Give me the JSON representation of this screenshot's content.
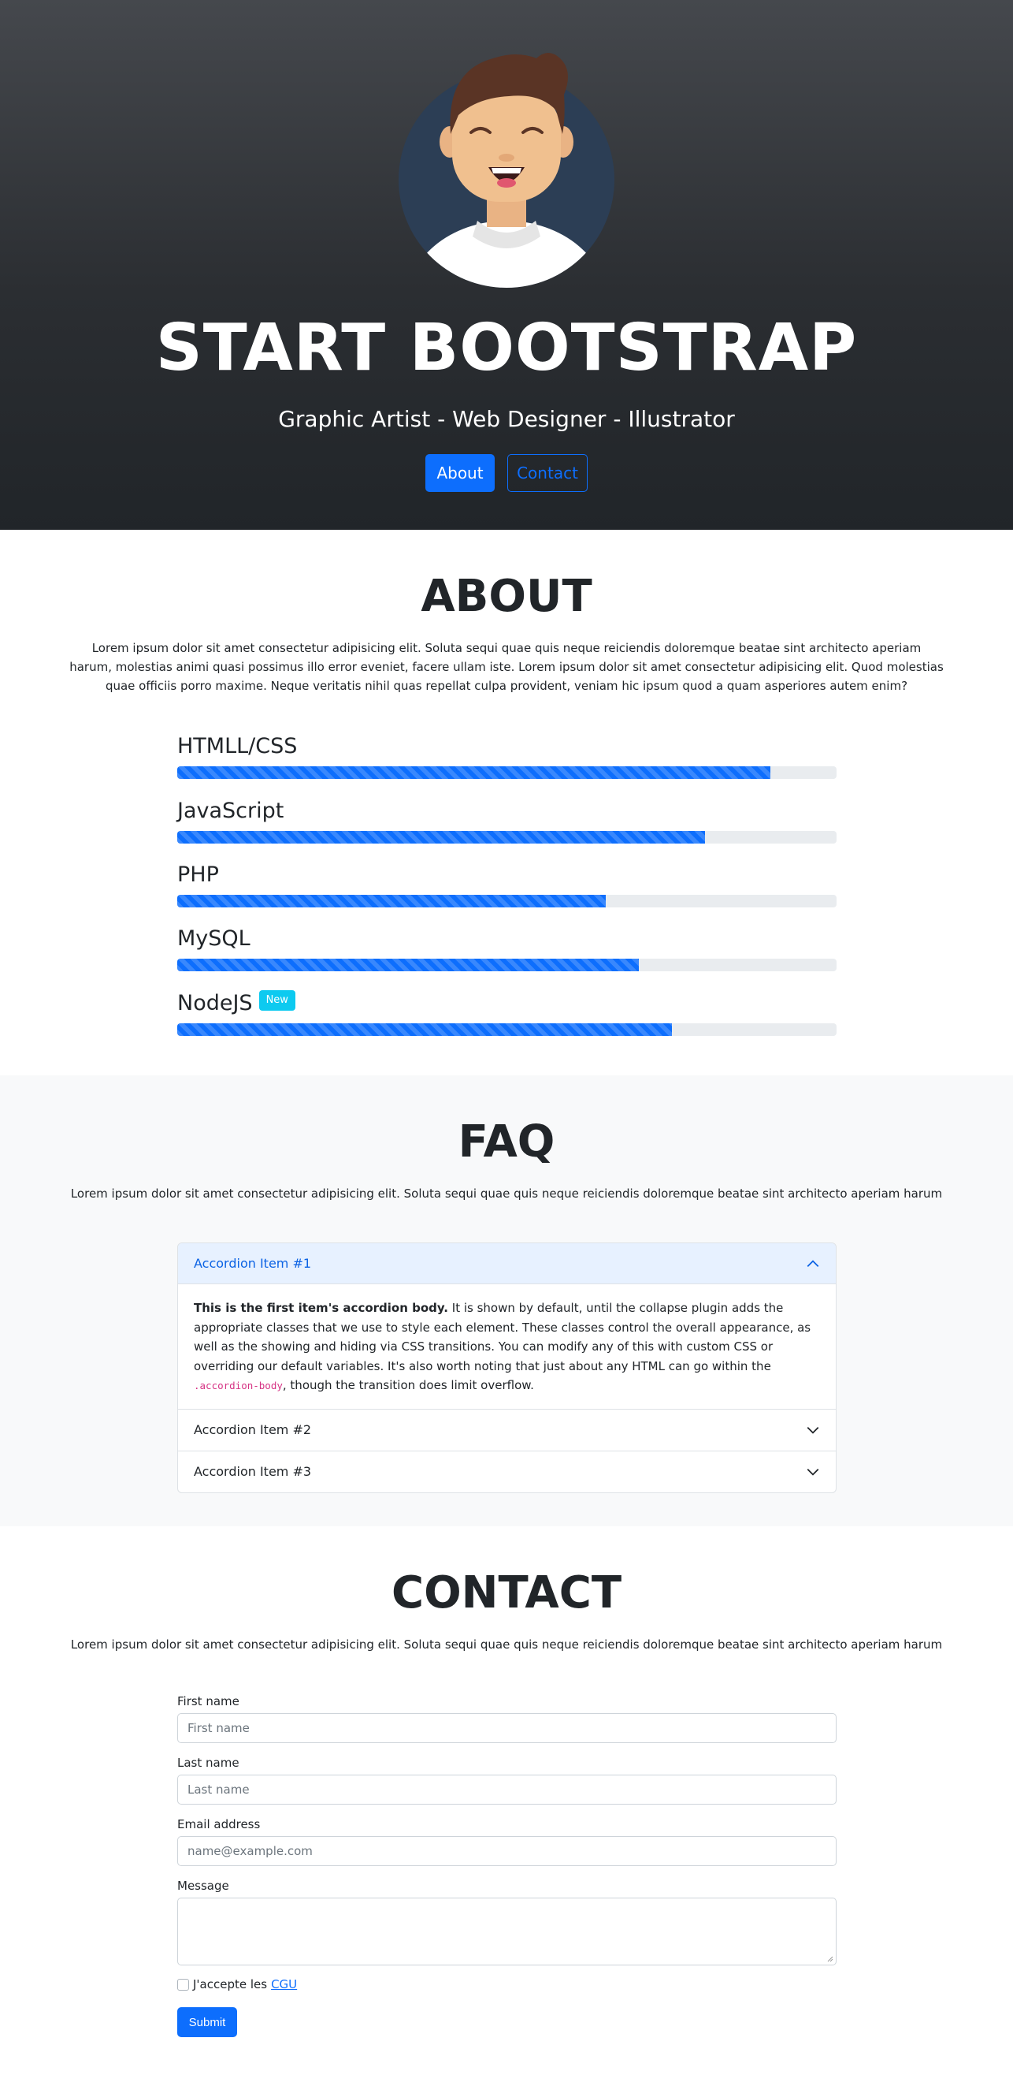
{
  "hero": {
    "title": "START BOOTSTRAP",
    "subtitle": "Graphic Artist - Web Designer - Illustrator",
    "about_btn": "About",
    "contact_btn": "Contact"
  },
  "about": {
    "title": "ABOUT",
    "text": "Lorem ipsum dolor sit amet consectetur adipisicing elit. Soluta sequi quae quis neque reiciendis doloremque beatae sint architecto aperiam harum, molestias animi quasi possimus illo error eveniet, facere ullam iste. Lorem ipsum dolor sit amet consectetur adipisicing elit. Quod molestias quae officiis porro maxime. Neque veritatis nihil quas repellat culpa provident, veniam hic ipsum quod a quam asperiores autem enim?",
    "skills": [
      {
        "label": "HTMLL/CSS",
        "value": 90
      },
      {
        "label": "JavaScript",
        "value": 80
      },
      {
        "label": "PHP",
        "value": 65
      },
      {
        "label": "MySQL",
        "value": 70
      },
      {
        "label": "NodeJS",
        "value": 75,
        "badge": "New"
      }
    ]
  },
  "faq": {
    "title": "FAQ",
    "lead": "Lorem ipsum dolor sit amet consectetur adipisicing elit. Soluta sequi quae quis neque reiciendis doloremque beatae sint architecto aperiam harum",
    "items": [
      {
        "title": "Accordion Item #1",
        "body_strong": "This is the first item's accordion body.",
        "body_text": " It is shown by default, until the collapse plugin adds the appropriate classes that we use to style each element. These classes control the overall appearance, as well as the showing and hiding via CSS transitions. You can modify any of this with custom CSS or overriding our default variables. It's also worth noting that just about any HTML can go within the ",
        "body_code": ".accordion-body",
        "body_tail": ", though the transition does limit overflow."
      },
      {
        "title": "Accordion Item #2"
      },
      {
        "title": "Accordion Item #3"
      }
    ]
  },
  "contact": {
    "title": "CONTACT",
    "lead": "Lorem ipsum dolor sit amet consectetur adipisicing elit. Soluta sequi quae quis neque reiciendis doloremque beatae sint architecto aperiam harum",
    "first_name_label": "First name",
    "first_name_placeholder": "First name",
    "last_name_label": "Last name",
    "last_name_placeholder": "Last name",
    "email_label": "Email address",
    "email_placeholder": "name@example.com",
    "message_label": "Message",
    "checkbox_label": "J'accepte les",
    "checkbox_link": "CGU",
    "submit": "Submit"
  },
  "colors": {
    "primary": "#0d6efd",
    "badge": "#0dcaf0",
    "hero_dark": "#212529"
  }
}
